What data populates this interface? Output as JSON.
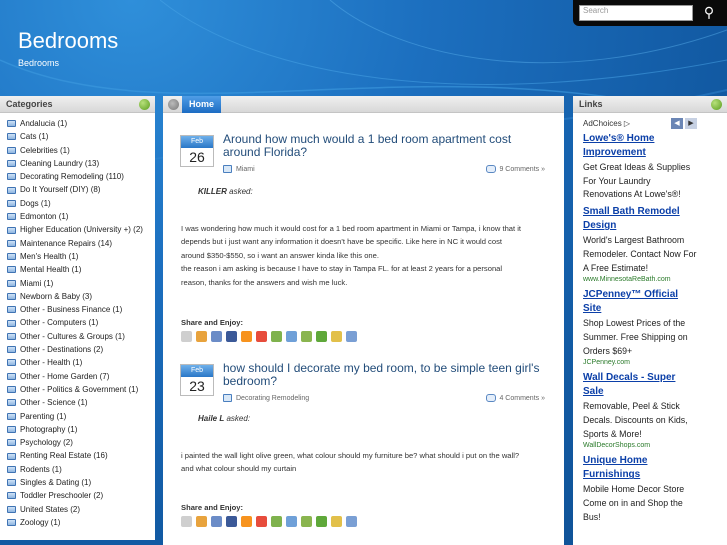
{
  "header": {
    "site_title": "Bedrooms",
    "tagline": "Bedrooms",
    "search_placeholder": "Search",
    "search_icon": "magnifier-icon"
  },
  "categories": {
    "title": "Categories",
    "items": [
      "Andalucia (1)",
      "Cats (1)",
      "Celebrities (1)",
      "Cleaning Laundry (13)",
      "Decorating Remodeling (110)",
      "Do It Yourself (DIY) (8)",
      "Dogs (1)",
      "Edmonton (1)",
      "Higher Education (University +) (2)",
      "Maintenance Repairs (14)",
      "Men's Health (1)",
      "Mental Health (1)",
      "Miami (1)",
      "Newborn & Baby (3)",
      "Other - Business Finance (1)",
      "Other - Computers (1)",
      "Other - Cultures & Groups (1)",
      "Other - Destinations (2)",
      "Other - Health (1)",
      "Other - Home Garden (7)",
      "Other - Politics & Government (1)",
      "Other - Science (1)",
      "Parenting (1)",
      "Photography (1)",
      "Psychology (2)",
      "Renting Real Estate (16)",
      "Rodents (1)",
      "Singles & Dating (1)",
      "Toddler Preschooler (2)",
      "United States (2)",
      "Zoology (1)"
    ]
  },
  "main": {
    "tab_label": "Home",
    "posts": [
      {
        "month": "Feb",
        "day": "26",
        "title": "Around how much would a 1 bed room apartment cost around Florida?",
        "category": "Miami",
        "comments": "9 Comments »",
        "author": "KILLER",
        "asked_label": "asked:",
        "body": [
          "I was wondering how much it would cost for a 1 bed room apartment in Miami or Tampa, i know that it",
          "depends but i just want any information it doesn't have be specific. Like here in NC it would cost",
          "around $350-$550, so i want an answer kinda like this one.",
          "the reason i am asking is because I have to stay in Tampa FL. for at least 2 years for a personal",
          "reason, thanks for the answers and wish me luck."
        ],
        "share_label": "Share and Enjoy:"
      },
      {
        "month": "Feb",
        "day": "23",
        "title": "how should I decorate my bed room, to be simple teen girl's bedroom?",
        "category": "Decorating Remodeling",
        "comments": "4 Comments »",
        "author": "Haile L",
        "asked_label": "asked:",
        "body": [
          "i painted the wall light olive green, what colour should my furniture be? what should i put on the wall?",
          "and what colour should my curtain"
        ],
        "share_label": "Share and Enjoy:"
      }
    ],
    "share_icon_colors": [
      "#cfcfcf",
      "#e8a33d",
      "#6b8cc7",
      "#3b5998",
      "#f7931e",
      "#e74c3c",
      "#7fb24d",
      "#6fa0d8",
      "#8ab54f",
      "#5fa83a",
      "#e2c04a",
      "#7a9fd4"
    ]
  },
  "links": {
    "title": "Links",
    "adchoices": "AdChoices",
    "ads": [
      {
        "title": "Lowe's® Home Improvement",
        "desc": "Get Great Ideas & Supplies For Your Laundry Renovations At Lowe's®!",
        "url": ""
      },
      {
        "title": "Small Bath Remodel Design",
        "desc": "World's Largest Bathroom Remodeler. Contact Now For A Free Estimate!",
        "url": "www.MinnesotaReBath.com"
      },
      {
        "title": "JCPenney™ Official Site",
        "desc": "Shop Lowest Prices of the Summer. Free Shipping on Orders $69+",
        "url": "JCPenney.com"
      },
      {
        "title": "Wall Decals - Super Sale",
        "desc": "Removable, Peel & Stick Decals. Discounts on Kids, Sports & More!",
        "url": "WallDecorShops.com"
      },
      {
        "title": "Unique Home Furnishings",
        "desc": "Mobile Home Decor Store Come on in and Shop the Bus!",
        "url": ""
      }
    ]
  }
}
